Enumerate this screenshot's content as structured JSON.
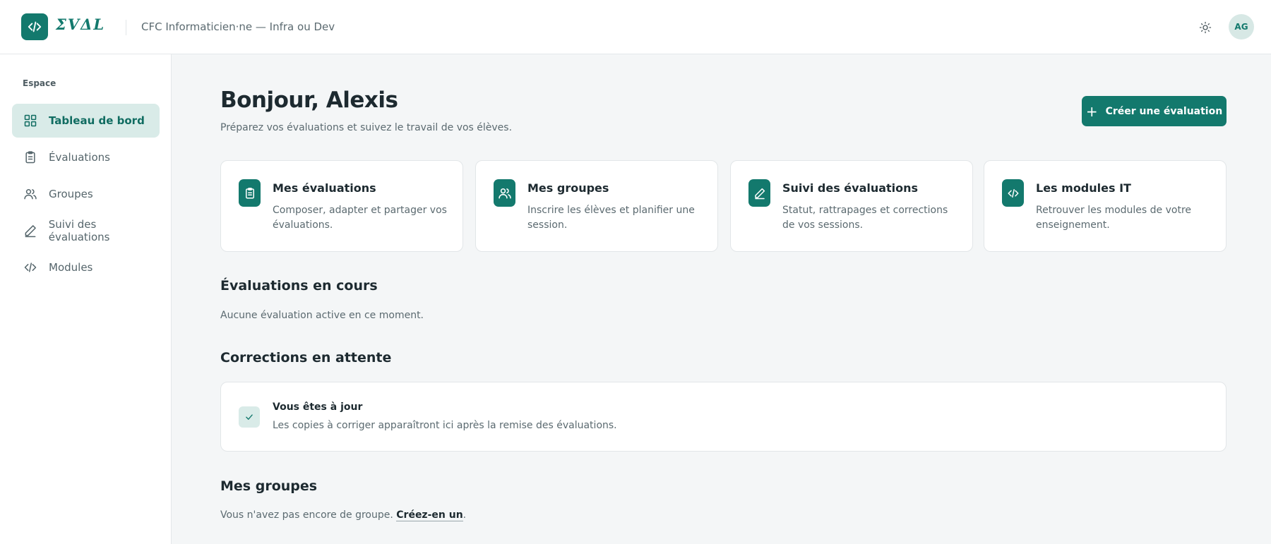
{
  "header": {
    "logo_text": "ΣVΔL",
    "course_title": "CFC Informaticien·ne — Infra ou Dev",
    "avatar_initials": "AG",
    "theme_icon": "sun-icon"
  },
  "sidebar": {
    "section_label": "Espace",
    "items": [
      {
        "label": "Tableau de bord",
        "icon": "grid-icon",
        "active": true
      },
      {
        "label": "Évaluations",
        "icon": "clipboard-icon",
        "active": false
      },
      {
        "label": "Groupes",
        "icon": "users-icon",
        "active": false
      },
      {
        "label": "Suivi des évaluations",
        "icon": "pencil-icon",
        "active": false
      },
      {
        "label": "Modules",
        "icon": "code-icon",
        "active": false
      }
    ]
  },
  "main": {
    "greeting": "Bonjour, Alexis",
    "subtitle": "Préparez vos évaluations et suivez le travail de vos élèves.",
    "create_button": "Créer une évaluation",
    "cards": [
      {
        "title": "Mes évaluations",
        "description": "Composer, adapter et partager vos évaluations.",
        "icon": "clipboard-icon"
      },
      {
        "title": "Mes groupes",
        "description": "Inscrire les élèves et planifier une session.",
        "icon": "users-icon"
      },
      {
        "title": "Suivi des évaluations",
        "description": "Statut, rattrapages et corrections de vos sessions.",
        "icon": "pencil-icon"
      },
      {
        "title": "Les modules IT",
        "description": "Retrouver les modules de votre enseignement.",
        "icon": "code-icon"
      }
    ],
    "active_section": {
      "title": "Évaluations en cours",
      "empty_text": "Aucune évaluation active en ce moment."
    },
    "corrections_section": {
      "title": "Corrections en attente",
      "status_title": "Vous êtes à jour",
      "status_text": "Les copies à corriger apparaîtront ici après la remise des évaluations."
    },
    "groups_section": {
      "title": "Mes groupes",
      "empty_text": "Vous n'avez pas encore de groupe. ",
      "create_link": "Créez-en un",
      "trailing": "."
    }
  },
  "colors": {
    "accent": "#13796d",
    "accent_light": "#d9ebe8",
    "background": "#f4f6f7"
  }
}
